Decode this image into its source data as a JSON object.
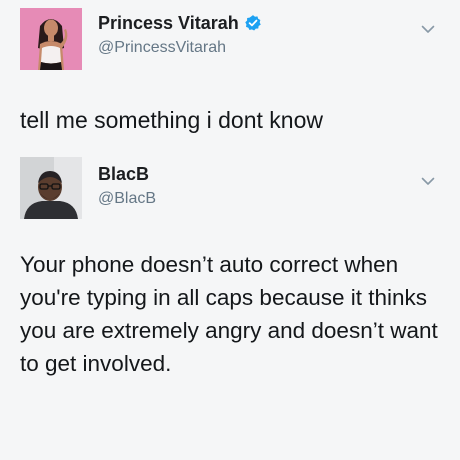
{
  "tweets": [
    {
      "display_name": "Princess Vitarah",
      "handle": "@PrincessVitarah",
      "verified": true,
      "text": "tell me something i dont know",
      "avatar_icon": "profile-photo",
      "avatar_bg": "#e68bb6"
    },
    {
      "display_name": "BlacB",
      "handle": "@BlacB",
      "verified": false,
      "text": "Your phone doesn’t auto correct when you're typing in all caps because it thinks you are extremely angry and doesn’t want to get involved.",
      "avatar_icon": "profile-photo",
      "avatar_bg": "#d7d9db"
    }
  ],
  "colors": {
    "verified_blue": "#1da1f2",
    "handle_gray": "#657786",
    "caret_gray": "#8899a6",
    "text": "#14171a"
  }
}
